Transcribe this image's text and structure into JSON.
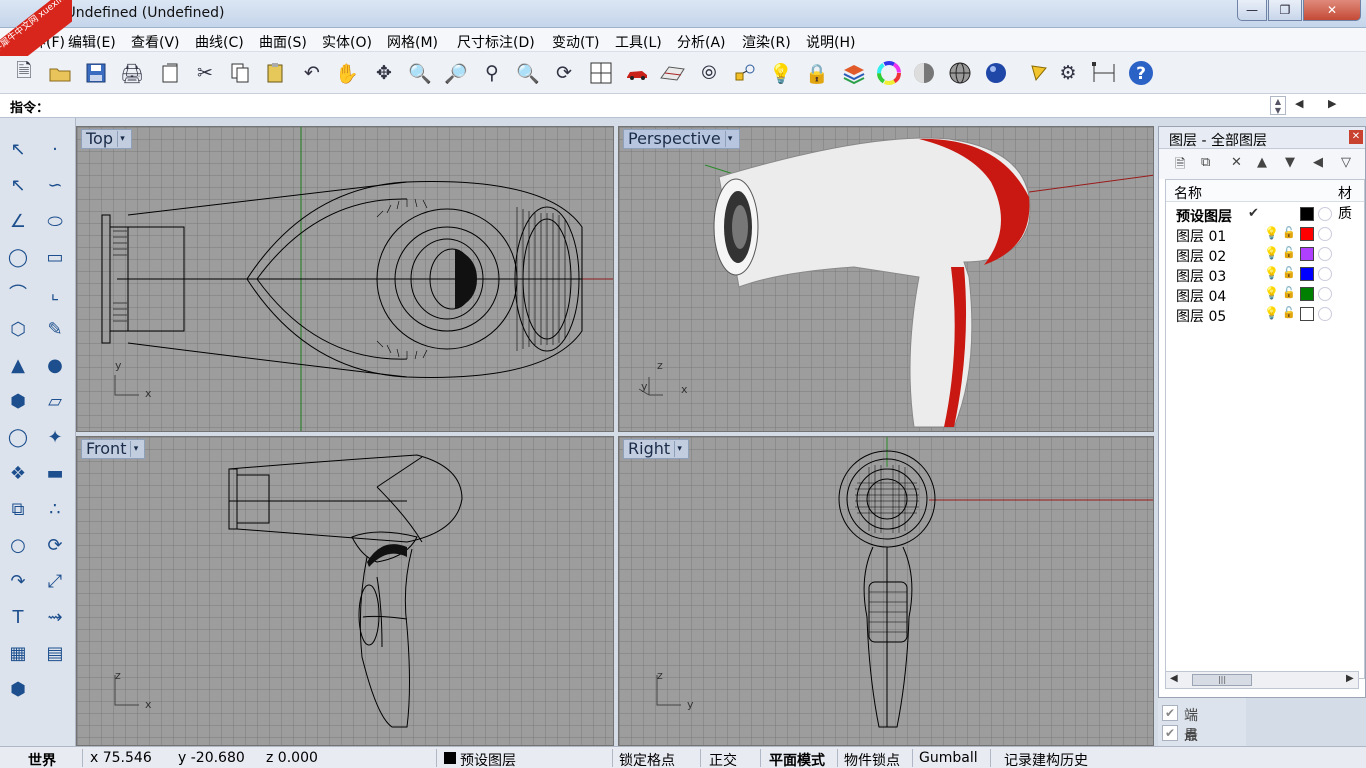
{
  "window": {
    "title": "Undefined (Undefined)",
    "title_prefix": "- ",
    "minimize": "—",
    "maximize": "❐",
    "close": "✕",
    "logo_text": "学犀牛中文网 xuexiniu"
  },
  "menu": [
    "世界(F)",
    "编辑(E)",
    "查看(V)",
    "曲线(C)",
    "曲面(S)",
    "实体(O)",
    "网格(M)",
    "尺寸标注(D)",
    "变动(T)",
    "工具(L)",
    "分析(A)",
    "渲染(R)",
    "说明(H)"
  ],
  "toolbar_icons": [
    "new-icon",
    "open-icon",
    "save-icon",
    "print-icon",
    "import-icon",
    "cut-icon",
    "copy-icon",
    "paste-icon",
    "undo-icon",
    "pan-icon",
    "rotate-view-icon",
    "zoom-icon",
    "zoom-window-icon",
    "zoom-extents-icon",
    "zoom-selected-icon",
    "undo-view-icon",
    "four-viewports-icon",
    "car-icon",
    "grid-plane-icon",
    "cplane-icon",
    "osnap-icon",
    "light-icon",
    "lock-icon",
    "layer-icon",
    "color-wheel-icon",
    "shade-icon",
    "wireframe-sphere-icon",
    "render-sphere-icon",
    "pen-icon",
    "settings-gear-icon",
    "dimension-icon",
    "help-icon"
  ],
  "command": {
    "label": "指令："
  },
  "viewports": {
    "top": {
      "name": "Top",
      "axis_y": "y",
      "axis_x": "x"
    },
    "perspective": {
      "name": "Perspective",
      "axis_z": "z",
      "axis_y": "y",
      "axis_x": "x"
    },
    "front": {
      "name": "Front",
      "axis_z": "z",
      "axis_x": "x"
    },
    "right": {
      "name": "Right",
      "axis_z": "z",
      "axis_y": "y"
    }
  },
  "layers_panel": {
    "title": "图层 - 全部图层",
    "col_name": "名称",
    "col_material": "材质",
    "rows": [
      {
        "name": "预设图层",
        "current": "✔",
        "color": "#000000"
      },
      {
        "name": "图层 01",
        "color": "#ff0000"
      },
      {
        "name": "图层 02",
        "color": "#b040ff"
      },
      {
        "name": "图层 03",
        "color": "#0000ff"
      },
      {
        "name": "图层 04",
        "color": "#008000"
      },
      {
        "name": "图层 05",
        "color": "#ffffff"
      }
    ]
  },
  "osnap": [
    {
      "label": "端点",
      "checked": "✔"
    },
    {
      "label": "最近点",
      "checked": "✔"
    }
  ],
  "status": {
    "world": "世界",
    "x": "x 75.546",
    "y": "y -20.680",
    "z": "z 0.000",
    "layer": "预设图层",
    "grid_snap": "锁定格点",
    "ortho": "正交",
    "planar": "平面模式",
    "osnap": "物件锁点",
    "gumball": "Gumball",
    "history": "记录建构历史"
  },
  "colors": {
    "viewport_bg": "#9d9d9d",
    "accent_red": "#d11a12",
    "title_bar": "#c5d5ea"
  }
}
